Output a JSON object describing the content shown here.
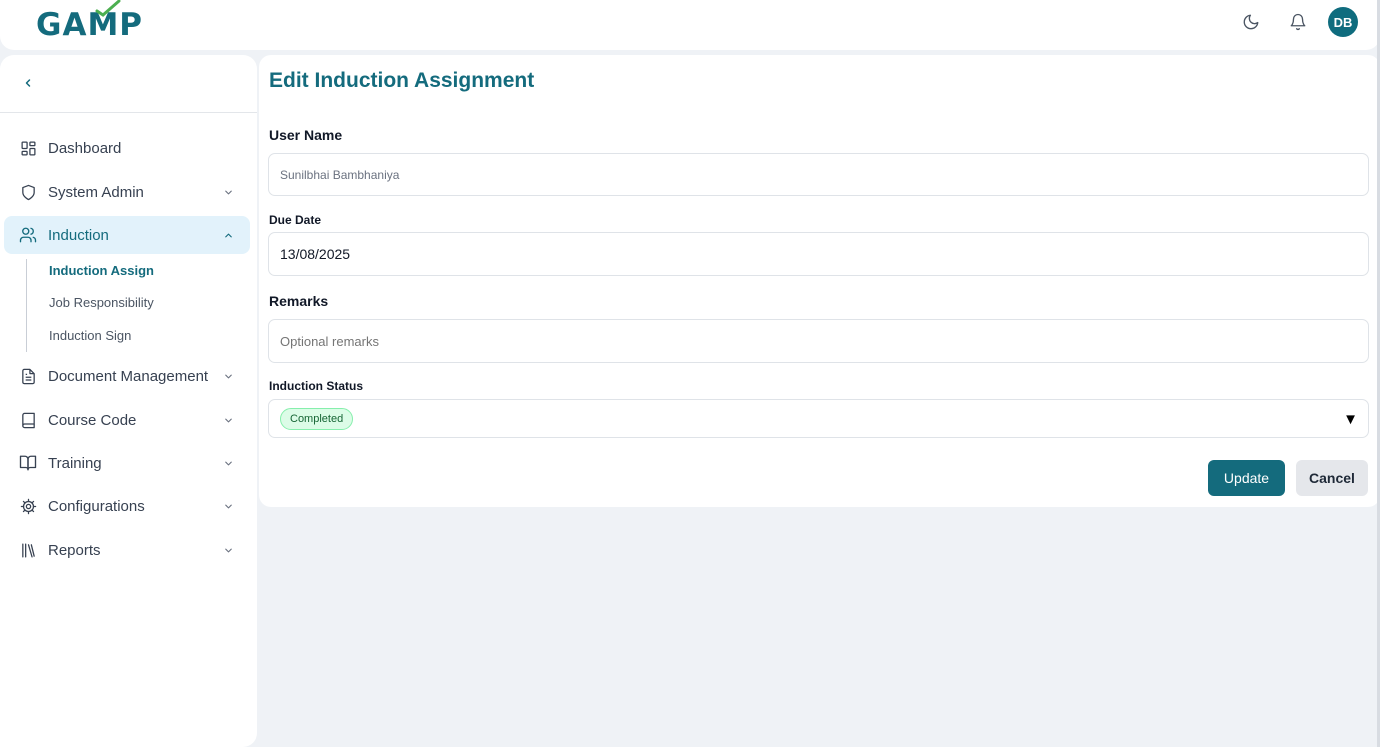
{
  "header": {
    "logo_text": "GAMP",
    "brand_color": "#146b7d",
    "theme_icon": "moon-icon",
    "notification_icon": "bell-icon",
    "user_initials": "DB"
  },
  "sidebar": {
    "collapse_icon": "chevron-left-icon",
    "items": [
      {
        "label": "Dashboard",
        "icon": "grid-icon"
      },
      {
        "label": "System Admin",
        "icon": "shield-icon"
      },
      {
        "label": "Induction",
        "icon": "users-icon"
      },
      {
        "label": "Document Management",
        "icon": "file-icon"
      },
      {
        "label": "Course Code",
        "icon": "book-icon"
      },
      {
        "label": "Training",
        "icon": "book-open-icon"
      },
      {
        "label": "Configurations",
        "icon": "gear-icon"
      },
      {
        "label": "Reports",
        "icon": "library-icon"
      }
    ],
    "induction_sub": [
      "Induction Assign",
      "Job Responsibility",
      "Induction Sign"
    ],
    "active_item": "Induction",
    "active_sub": "Induction Assign"
  },
  "form": {
    "title": "Edit Induction Assignment",
    "user_name_label": "User Name",
    "user_name_value": "Sunilbhai Bambhaniya",
    "due_date_label": "Due Date",
    "due_date_value": "13/08/2025",
    "remarks_label": "Remarks",
    "remarks_placeholder": "Optional remarks",
    "status_label": "Induction Status",
    "status_value": "Completed",
    "update_label": "Update",
    "cancel_label": "Cancel"
  }
}
